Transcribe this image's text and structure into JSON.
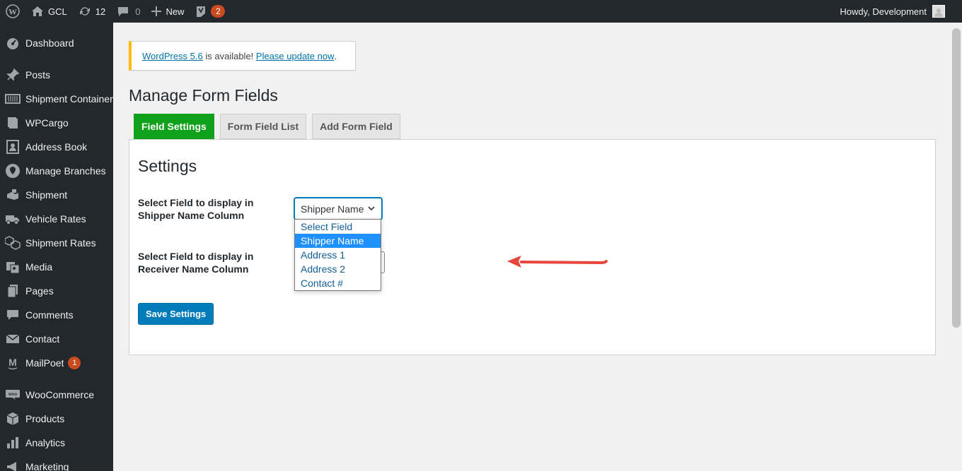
{
  "admin_bar": {
    "site_name": "GCL",
    "updates_count": "12",
    "comments_count": "0",
    "new_label": "New",
    "yoast_badge": "2",
    "howdy": "Howdy, Development"
  },
  "sidebar": {
    "items": [
      {
        "label": "Dashboard",
        "icon": "dashboard-icon"
      },
      {
        "label": "Posts",
        "icon": "pin-icon"
      },
      {
        "label": "Shipment Container",
        "icon": "container-icon"
      },
      {
        "label": "WPCargo",
        "icon": "book-icon"
      },
      {
        "label": "Address Book",
        "icon": "contact-card-icon"
      },
      {
        "label": "Manage Branches",
        "icon": "location-icon"
      },
      {
        "label": "Shipment",
        "icon": "shipment-icon"
      },
      {
        "label": "Vehicle Rates",
        "icon": "truck-icon"
      },
      {
        "label": "Shipment Rates",
        "icon": "boxes-icon"
      },
      {
        "label": "Media",
        "icon": "media-icon"
      },
      {
        "label": "Pages",
        "icon": "pages-icon"
      },
      {
        "label": "Comments",
        "icon": "comment-icon"
      },
      {
        "label": "Contact",
        "icon": "mail-icon"
      },
      {
        "label": "MailPoet",
        "icon": "mailpoet-icon",
        "badge": "1"
      },
      {
        "label": "WooCommerce",
        "icon": "woo-icon"
      },
      {
        "label": "Products",
        "icon": "box-icon"
      },
      {
        "label": "Analytics",
        "icon": "bar-chart-icon"
      },
      {
        "label": "Marketing",
        "icon": "megaphone-icon"
      }
    ]
  },
  "notice": {
    "link1": "WordPress 5.6",
    "middle": " is available! ",
    "link2": "Please update now",
    "end": "."
  },
  "page": {
    "title": "Manage Form Fields",
    "tabs": [
      {
        "label": "Field Settings",
        "active": true
      },
      {
        "label": "Form Field List",
        "active": false
      },
      {
        "label": "Add Form Field",
        "active": false
      }
    ]
  },
  "settings": {
    "title": "Settings",
    "shipper_label_line1": "Select Field to display in",
    "shipper_label_line2": "Shipper Name Column",
    "shipper_value": "Shipper Name",
    "receiver_label_line1": "Select Field to display in",
    "receiver_label_line2": "Receiver Name Column",
    "save_label": "Save Settings"
  },
  "dropdown": {
    "options": [
      "Select Field",
      "Shipper Name",
      "Address 1",
      "Address 2",
      "Contact #"
    ],
    "selected": "Shipper Name"
  },
  "colors": {
    "admin_bar": "#23282d",
    "active_tab": "#11a01b",
    "primary_button": "#007cba",
    "badge": "#ca4a1f",
    "notice_border": "#ffb900",
    "selected_option": "#1e90ff",
    "arrow": "#e8453c"
  }
}
